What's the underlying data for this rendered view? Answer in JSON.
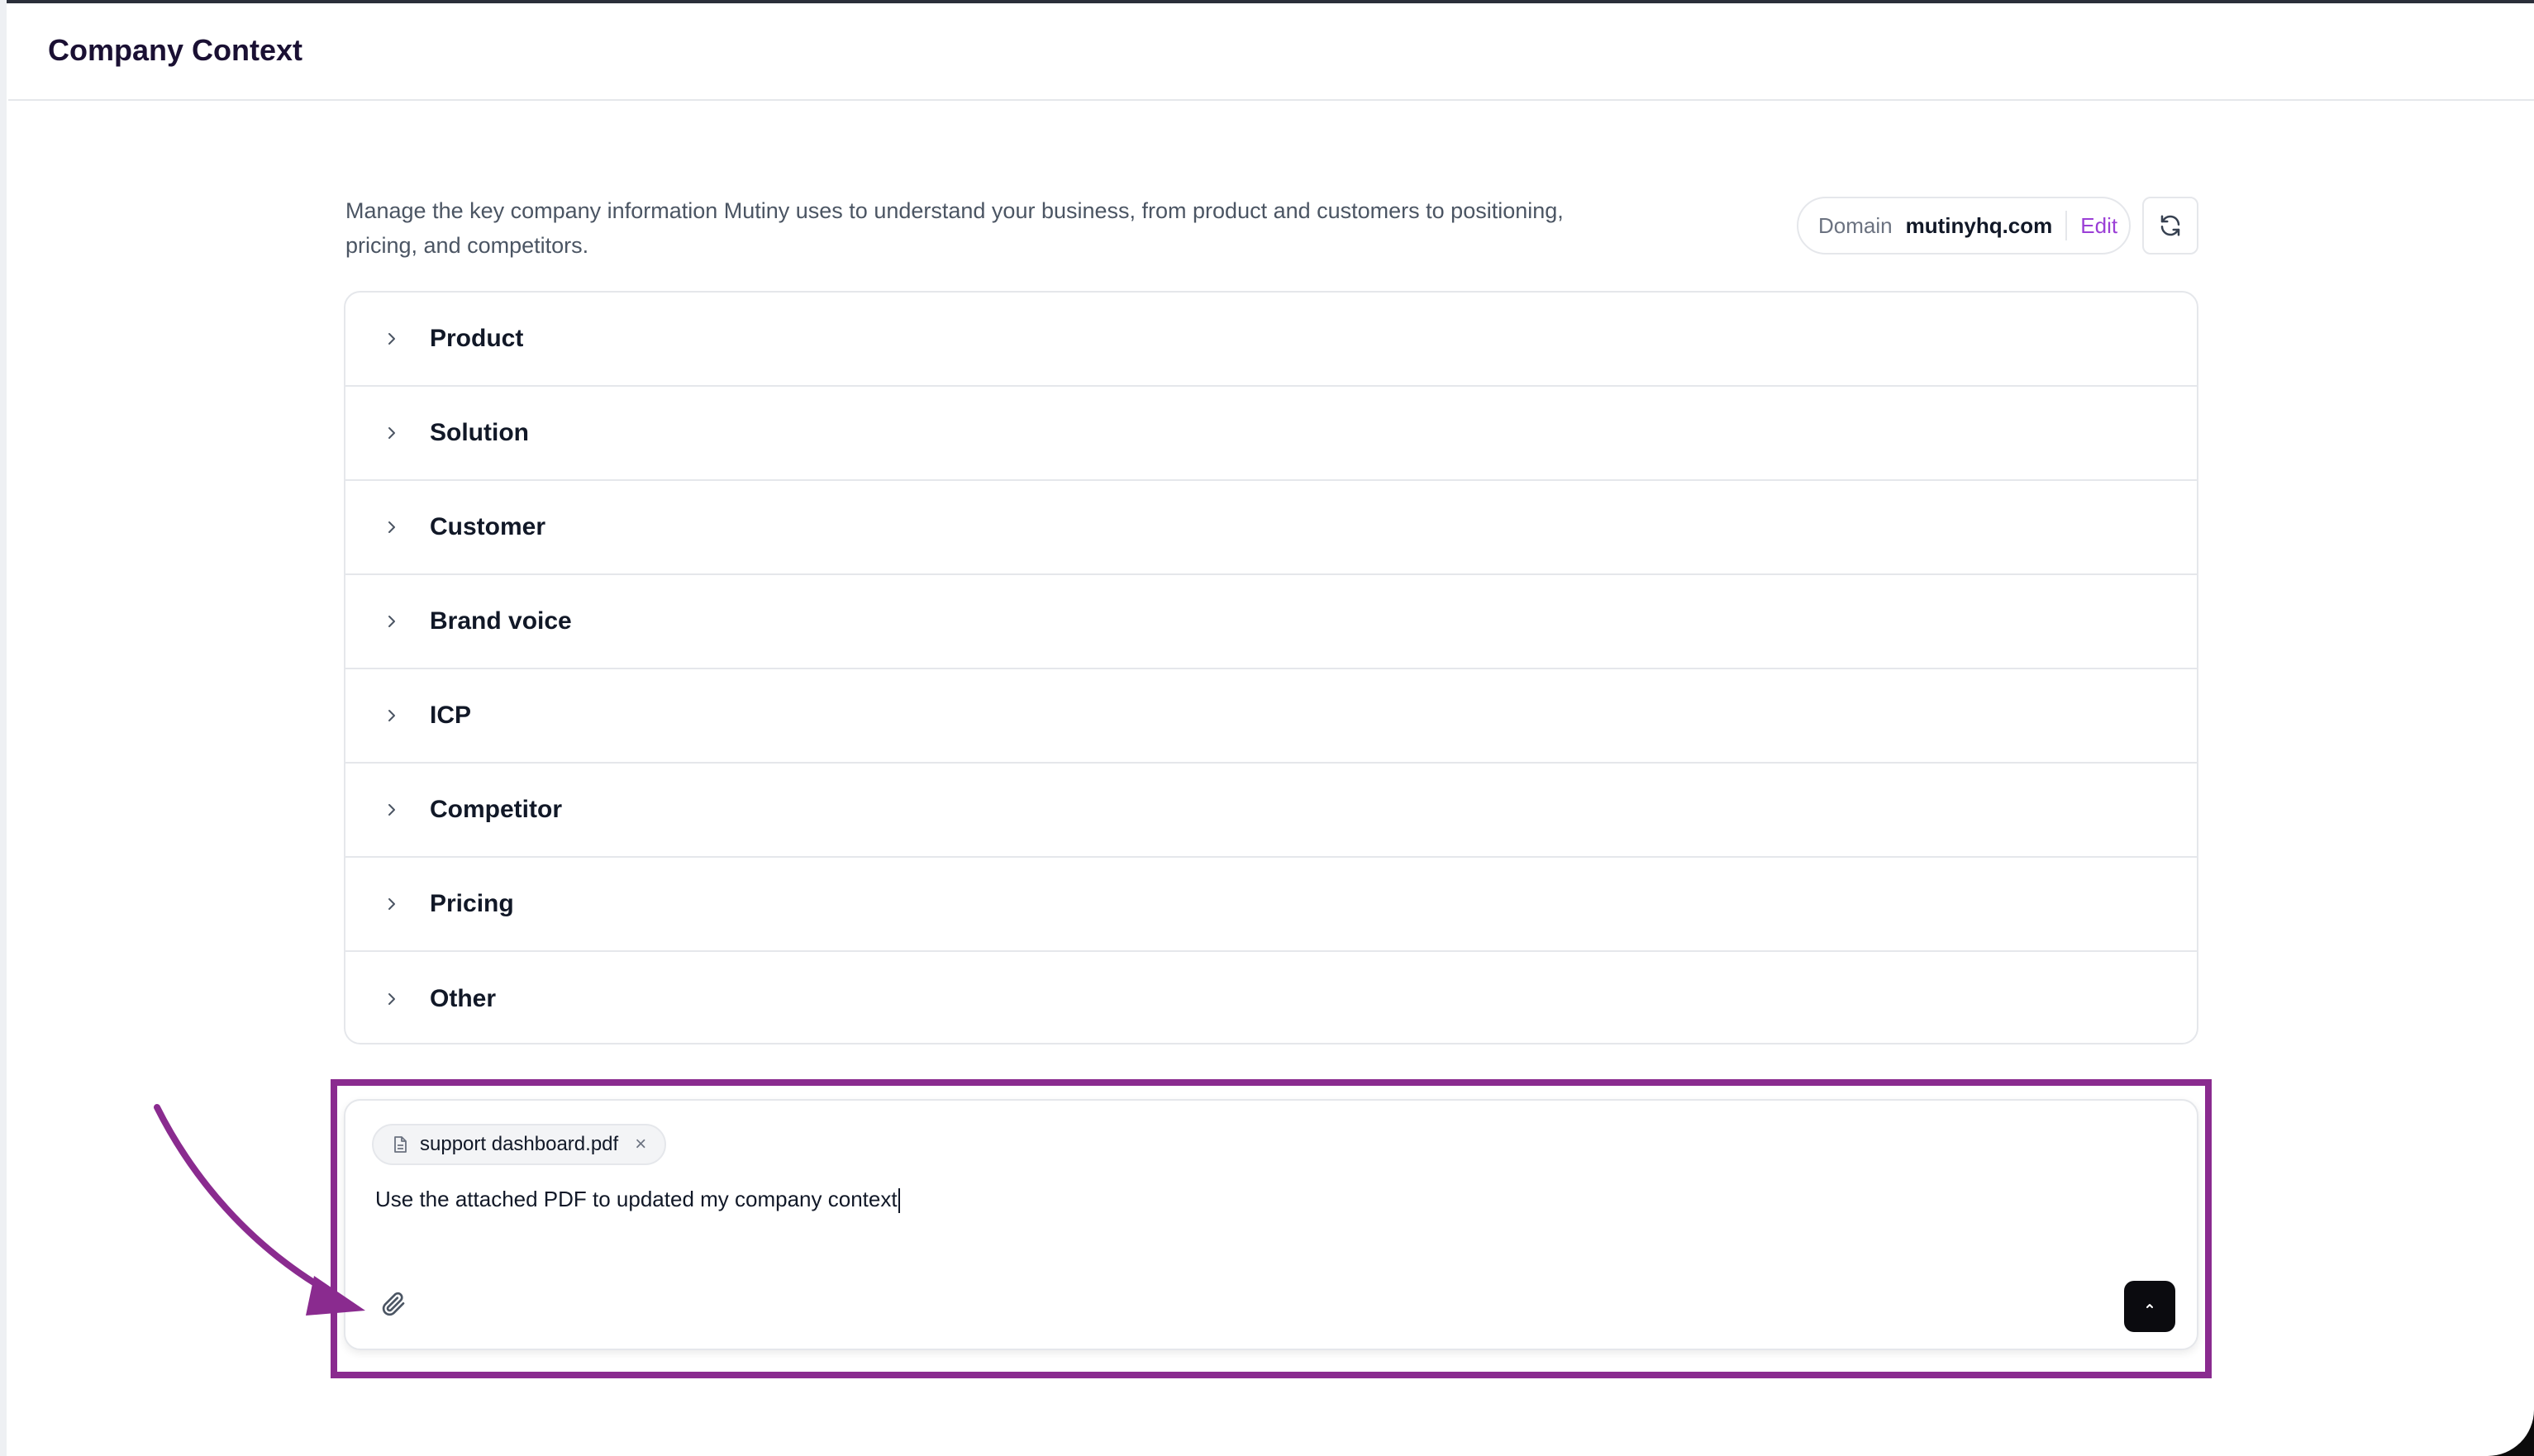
{
  "header": {
    "title": "Company Context"
  },
  "intro": {
    "description": "Manage the key company information Mutiny uses to understand your business, from product and customers to positioning, pricing, and competitors."
  },
  "domain": {
    "label": "Domain",
    "value": "mutinyhq.com",
    "edit_label": "Edit"
  },
  "sections": [
    {
      "label": "Product"
    },
    {
      "label": "Solution"
    },
    {
      "label": "Customer"
    },
    {
      "label": "Brand voice"
    },
    {
      "label": "ICP"
    },
    {
      "label": "Competitor"
    },
    {
      "label": "Pricing"
    },
    {
      "label": "Other"
    }
  ],
  "composer": {
    "attachment_name": "support dashboard.pdf",
    "attachment_remove": "×",
    "message": "Use the attached PDF to updated my company context"
  },
  "icons": {
    "refresh": "refresh-icon",
    "chevron": "chevron-right-icon",
    "file": "file-icon",
    "attach": "paperclip-icon",
    "send": "arrow-up-icon"
  },
  "colors": {
    "accent": "#9b3fd6",
    "annotation": "#8a2b8f",
    "send_button": "#0b0b0f"
  }
}
